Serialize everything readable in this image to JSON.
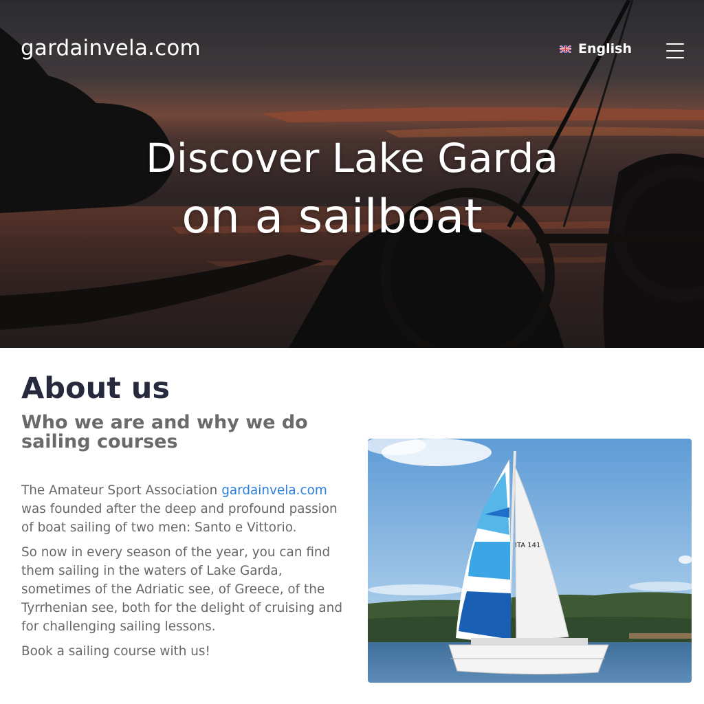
{
  "header": {
    "brand": "gardainvela.com",
    "language": "English"
  },
  "hero": {
    "line1": "Discover Lake Garda",
    "line2": "on a sailboat"
  },
  "about": {
    "title": "About us",
    "subtitle": "Who we are and why we do sailing courses",
    "p1_before": "The Amateur Sport Association ",
    "p1_link": "gardainvela.com",
    "p1_after": " was founded after the deep and profound passion of boat sailing of two men: Santo e Vittorio.",
    "p2": "So now in every season of the year, you can find them sailing in the waters of Lake Garda, sometimes of the Adriatic see, of Greece, of the Tyrrhenian see, both for the delight of cruising and for challenging sailing lessons.",
    "p3": "Book a sailing course with us!",
    "photo_sail_number": "ITA 141"
  }
}
